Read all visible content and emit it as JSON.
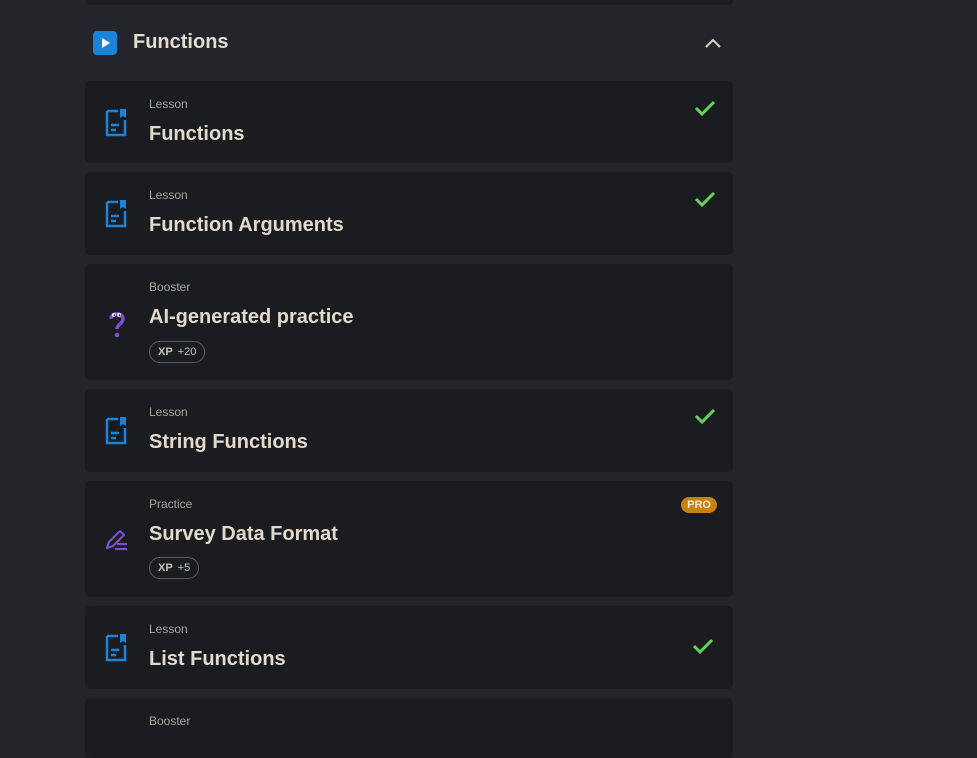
{
  "section": {
    "title": "Functions"
  },
  "items": [
    {
      "kind": "Lesson",
      "title": "Functions",
      "completed": true,
      "icon": "lesson-doc-icon"
    },
    {
      "kind": "Lesson",
      "title": "Function Arguments",
      "completed": true,
      "icon": "lesson-doc-icon"
    },
    {
      "kind": "Booster",
      "title": "AI-generated practice",
      "xp_label": "XP",
      "xp_value": "+20",
      "icon": "booster-question-icon"
    },
    {
      "kind": "Lesson",
      "title": "String Functions",
      "completed": true,
      "icon": "lesson-doc-icon"
    },
    {
      "kind": "Practice",
      "title": "Survey Data Format",
      "badge": "PRO",
      "xp_label": "XP",
      "xp_value": "+5",
      "icon": "practice-pencil-icon"
    },
    {
      "kind": "Lesson",
      "title": "List Functions",
      "completed": true,
      "icon": "lesson-doc-icon"
    },
    {
      "kind": "Booster",
      "title": "",
      "icon": "booster-question-icon"
    }
  ],
  "colors": {
    "background": "#24252a",
    "card": "#1b1c20",
    "lesson_icon": "#1a84d8",
    "booster_icon": "#7a4cd8",
    "check": "#5fd35a",
    "pro": "#c8820f"
  }
}
